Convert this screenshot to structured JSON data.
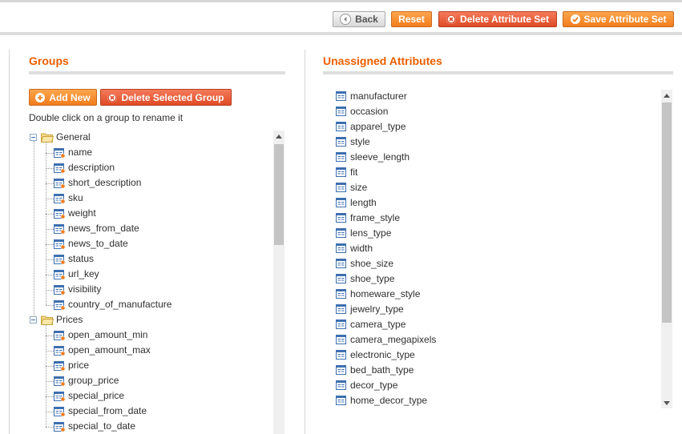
{
  "toolbar": {
    "back_label": "Back",
    "reset_label": "Reset",
    "delete_set_label": "Delete Attribute Set",
    "save_set_label": "Save Attribute Set"
  },
  "groups": {
    "title": "Groups",
    "add_new_label": "Add New",
    "delete_group_label": "Delete Selected Group",
    "hint": "Double click on a group to rename it",
    "tree": [
      {
        "name": "General",
        "items": [
          "name",
          "description",
          "short_description",
          "sku",
          "weight",
          "news_from_date",
          "news_to_date",
          "status",
          "url_key",
          "visibility",
          "country_of_manufacture"
        ]
      },
      {
        "name": "Prices",
        "items": [
          "open_amount_min",
          "open_amount_max",
          "price",
          "group_price",
          "special_price",
          "special_from_date",
          "special_to_date"
        ]
      }
    ]
  },
  "unassigned": {
    "title": "Unassigned Attributes",
    "items": [
      "manufacturer",
      "occasion",
      "apparel_type",
      "style",
      "sleeve_length",
      "fit",
      "size",
      "length",
      "frame_style",
      "lens_type",
      "width",
      "shoe_size",
      "shoe_type",
      "homeware_style",
      "jewelry_type",
      "camera_type",
      "camera_megapixels",
      "electronic_type",
      "bed_bath_type",
      "decor_type",
      "home_decor_type"
    ]
  },
  "colors": {
    "accent": "#eb5e00",
    "button_orange": "#f27d1c",
    "button_red": "#de4b25"
  },
  "icons": {
    "back": "back-arrow-icon",
    "delete": "x-circle-icon",
    "save": "check-circle-icon",
    "add": "plus-circle-icon",
    "folder": "folder-icon",
    "attribute": "attribute-icon",
    "collapse": "minus-box-icon"
  }
}
